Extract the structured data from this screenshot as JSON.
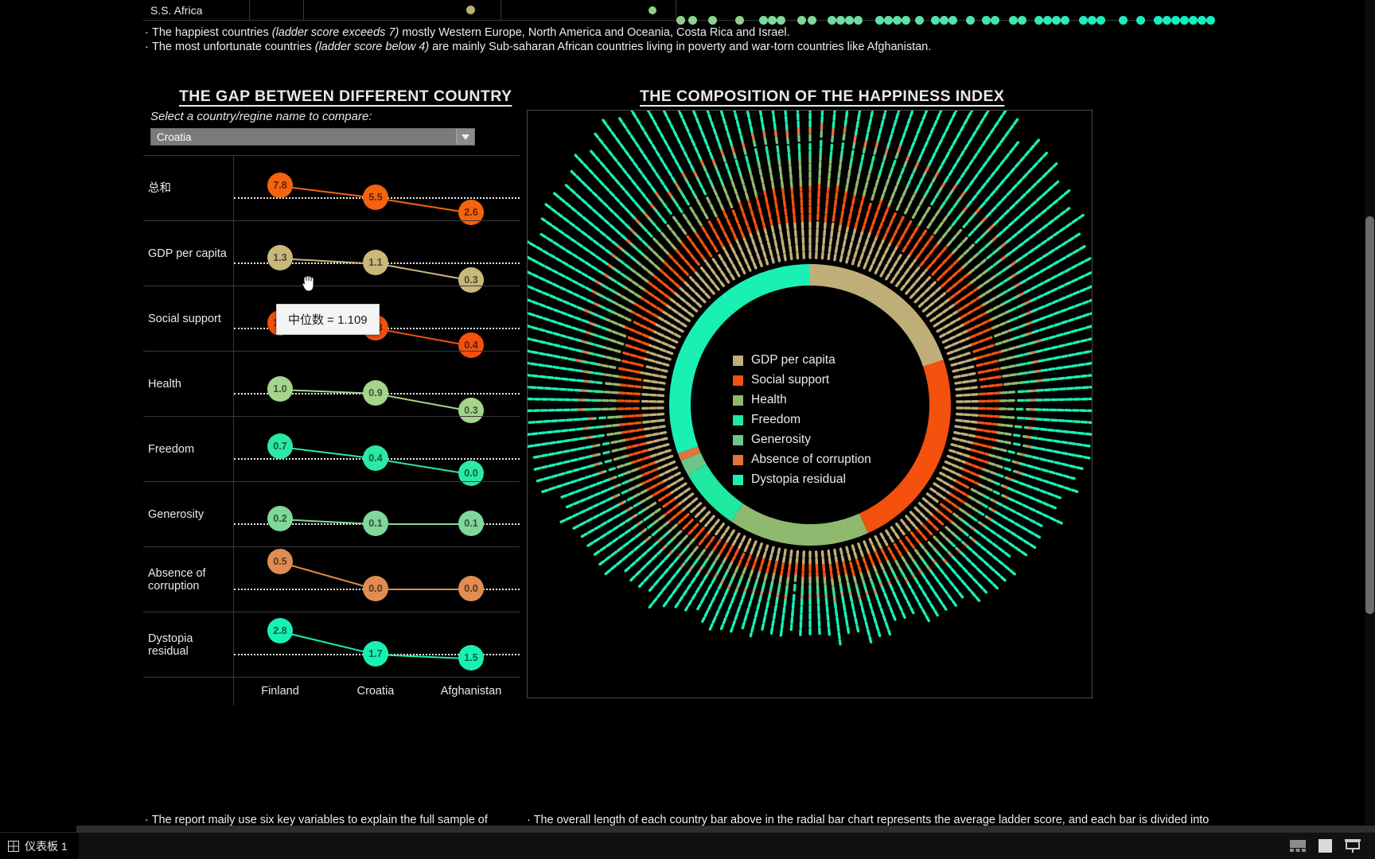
{
  "top_row": {
    "label": "S.S. Africa",
    "groups": [
      {
        "dots": [
          {
            "c": "#b9b06a",
            "s": 11
          }
        ]
      },
      {
        "dots": [
          {
            "c": "#8fd18a",
            "s": 11
          },
          {
            "c": "#8fd18a",
            "s": 11
          },
          {
            "c": "#8fd18a",
            "s": 10
          },
          {
            "gap": 22
          },
          {
            "c": "#8fd18a",
            "s": 10
          }
        ]
      }
    ]
  },
  "notes_top": [
    {
      "pre": "The happiest countries ",
      "em": "(ladder score exceeds 7)",
      "post": " mostly Western Europe, North  America and Oceania, Costa Rica and Israel."
    },
    {
      "pre": "The most unfortunate countries ",
      "em": "(ladder score below 4)",
      "post": " are mainly Sub-saharan African countries living in poverty and war-torn countries like Afghanistan."
    }
  ],
  "left": {
    "title": "THE GAP BETWEEN DIFFERENT COUNTRY",
    "select_label": "Select a country/regine name to compare:",
    "selected_country": "Croatia",
    "tooltip": "中位数 = 1.109"
  },
  "right": {
    "title": "THE COMPOSITION OF THE HAPPINESS INDEX",
    "legend": [
      {
        "label": "GDP per capita",
        "color": "#bfae78"
      },
      {
        "label": "Social support",
        "color": "#f4500e"
      },
      {
        "label": "Health",
        "color": "#8fb96e"
      },
      {
        "label": "Freedom",
        "color": "#1fe8a0"
      },
      {
        "label": "Generosity",
        "color": "#6cc58b"
      },
      {
        "label": "Absence of corruption",
        "color": "#e1743c"
      },
      {
        "label": "Dystopia residual",
        "color": "#19f0b4"
      }
    ]
  },
  "chart_data": [
    {
      "type": "line",
      "title": "THE GAP BETWEEN DIFFERENT COUNTRY",
      "categories": [
        "Finland",
        "Croatia",
        "Afghanistan"
      ],
      "xlabel": "",
      "ylabel": "",
      "median_annotation": "中位数 = 1.109",
      "series": [
        {
          "name": "总和",
          "values": [
            7.8,
            5.5,
            2.6
          ],
          "color": "#f4630e",
          "median": 5.5
        },
        {
          "name": "GDP per capita",
          "values": [
            1.3,
            1.1,
            0.3
          ],
          "color": "#c8b87a",
          "median": 1.109
        },
        {
          "name": "Social support",
          "values": [
            1.5,
            1.3,
            0.4
          ],
          "color": "#f4500e",
          "median": 1.3
        },
        {
          "name": "Health",
          "values": [
            1.0,
            0.9,
            0.3
          ],
          "color": "#a5d58a",
          "median": 0.9
        },
        {
          "name": "Freedom",
          "values": [
            0.7,
            0.4,
            0.0
          ],
          "color": "#2ce8a5",
          "median": 0.4
        },
        {
          "name": "Generosity",
          "values": [
            0.2,
            0.1,
            0.1
          ],
          "color": "#7fd89a",
          "median": 0.1
        },
        {
          "name": "Absence of corruption",
          "values": [
            0.5,
            0.0,
            0.0
          ],
          "color": "#e08c52",
          "median": 0.0
        },
        {
          "name": "Dystopia residual",
          "values": [
            2.8,
            1.7,
            1.5
          ],
          "color": "#19f0b4",
          "median": 1.7
        }
      ]
    },
    {
      "type": "pie",
      "title": "THE COMPOSITION OF THE HAPPINESS INDEX",
      "labels": [
        "GDP per capita",
        "Social support",
        "Health",
        "Freedom",
        "Generosity",
        "Absence of corruption",
        "Dystopia residual"
      ],
      "colors": [
        "#bfae78",
        "#f4500e",
        "#8fb96e",
        "#1fe8a0",
        "#6cc58b",
        "#e1743c",
        "#19f0b4"
      ],
      "values": [
        1.1,
        1.3,
        0.9,
        0.4,
        0.1,
        0.05,
        1.7
      ],
      "legend_position": "center"
    }
  ],
  "notes_bottom": {
    "left": "· The report maily use six key variables to explain the full sample of national annual average scores.  These variables are GDP per capita,",
    "right": "· The overall length of each country bar above in the radial bar chart represents the average ladder score, and each bar is divided into seven segments. The first six sub-bars show how much each of the six key"
  },
  "taskbar": {
    "tab_label": "仪表板 1"
  }
}
